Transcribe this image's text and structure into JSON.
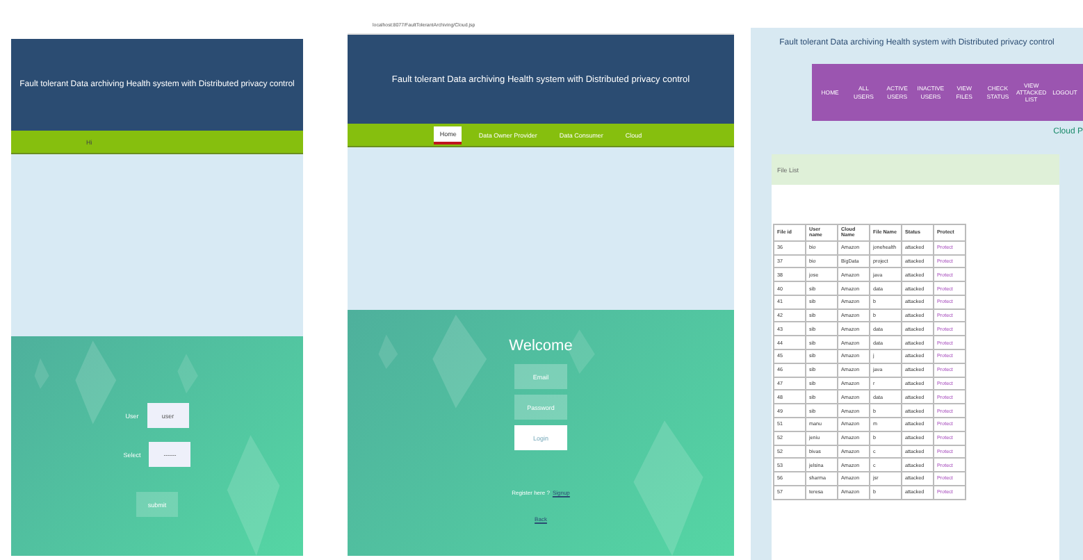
{
  "panels": [
    {
      "kind": "login_select",
      "title": "Fault tolerant Data archiving Health system with Distributed privacy control",
      "nav": [
        {
          "label": "Hi",
          "selected": false
        }
      ],
      "fields": [
        {
          "label": "User",
          "value": "user"
        },
        {
          "label": "Select",
          "value": "------"
        }
      ],
      "button": "submit"
    },
    {
      "kind": "login",
      "address": "localhost:8077/FaultTolerantArchiving/Cloud.jsp",
      "title": "Fault tolerant Data archiving Health system with Distributed privacy control",
      "nav": [
        {
          "label": "Home",
          "selected": true
        },
        {
          "label": "Data Owner Provider",
          "selected": false
        },
        {
          "label": "Data Consumer",
          "selected": false
        },
        {
          "label": "Cloud",
          "selected": false
        }
      ],
      "heading": "Welcome",
      "fields": [
        {
          "placeholder": "Email"
        },
        {
          "placeholder": "Password"
        }
      ],
      "button": "Login",
      "register_text": "Register here ?",
      "register_link": "Signup",
      "back_link": "Back"
    },
    {
      "kind": "table",
      "title": "Fault tolerant Data archiving Health system with Distributed privacy control",
      "nav": [
        {
          "label": "HOME"
        },
        {
          "label": "ALL USERS"
        },
        {
          "label": "ACTIVE USERS"
        },
        {
          "label": "INACTIVE USERS"
        },
        {
          "label": "VIEW FILES"
        },
        {
          "label": "CHECK STATUS"
        },
        {
          "label": "VIEW ATTACKED LIST"
        },
        {
          "label": "LOGOUT"
        }
      ],
      "cut_label": "Cloud P",
      "card_title": "File List",
      "columns": [
        "File id",
        "User name",
        "Cloud Name",
        "File Name",
        "Status",
        "Protect"
      ],
      "rows": [
        [
          "36",
          "bio",
          "Amazon",
          "jonehealth",
          "attacked",
          "Protect"
        ],
        [
          "37",
          "bio",
          "BigData",
          "project",
          "attacked",
          "Protect"
        ],
        [
          "38",
          "jose",
          "Amazon",
          "java",
          "attacked",
          "Protect"
        ],
        [
          "40",
          "sib",
          "Amazon",
          "data",
          "attacked",
          "Protect"
        ],
        [
          "41",
          "sib",
          "Amazon",
          "b",
          "attacked",
          "Protect"
        ],
        [
          "42",
          "sib",
          "Amazon",
          "b",
          "attacked",
          "Protect"
        ],
        [
          "43",
          "sib",
          "Amazon",
          "data",
          "attacked",
          "Protect"
        ],
        [
          "44",
          "sib",
          "Amazon",
          "data",
          "attacked",
          "Protect"
        ],
        [
          "45",
          "sib",
          "Amazon",
          "j",
          "attacked",
          "Protect"
        ],
        [
          "46",
          "sib",
          "Amazon",
          "java",
          "attacked",
          "Protect"
        ],
        [
          "47",
          "sib",
          "Amazon",
          "r",
          "attacked",
          "Protect"
        ],
        [
          "48",
          "sib",
          "Amazon",
          "data",
          "attacked",
          "Protect"
        ],
        [
          "49",
          "sib",
          "Amazon",
          "b",
          "attacked",
          "Protect"
        ],
        [
          "51",
          "manu",
          "Amazon",
          "m",
          "attacked",
          "Protect"
        ],
        [
          "52",
          "jeniu",
          "Amazon",
          "b",
          "attacked",
          "Protect"
        ],
        [
          "52",
          "bivas",
          "Amazon",
          "c",
          "attacked",
          "Protect"
        ],
        [
          "53",
          "jelsina",
          "Amazon",
          "c",
          "attacked",
          "Protect"
        ],
        [
          "56",
          "sharma",
          "Amazon",
          "jsr",
          "attacked",
          "Protect"
        ],
        [
          "57",
          "teresa",
          "Amazon",
          "b",
          "attacked",
          "Protect"
        ]
      ]
    }
  ]
}
